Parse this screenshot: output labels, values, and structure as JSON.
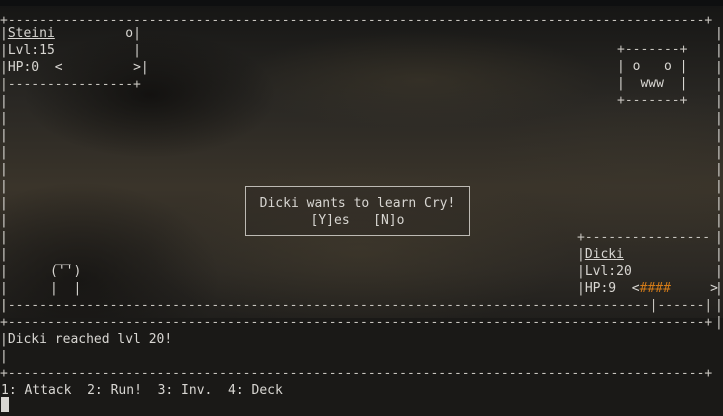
{
  "player": {
    "name": "Steini",
    "marker": "o",
    "level_label": "Lvl:15",
    "hp_label": "HP:0",
    "hp_left": "<",
    "hp_right": ">"
  },
  "enemy_sprite": {
    "line1": "o   o",
    "line2": "www"
  },
  "player_sprite": {
    "line1": "__",
    "line2": "('')",
    "line3": "|  |"
  },
  "pet": {
    "name": "Dicki",
    "level_label": "Lvl:20",
    "hp_label": "HP:9",
    "hp_left": "<",
    "hp_bar": "####",
    "hp_right": ">",
    "hp_bar_fraction": 0.45
  },
  "dialog": {
    "message": "Dicki wants to learn Cry!",
    "option_yes": "[Y]es",
    "option_no": "[N]o"
  },
  "log": {
    "message": "Dicki reached lvl 20!"
  },
  "menu": {
    "attack": "1: Attack",
    "run": "2: Run!",
    "inventory": "3: Inv.",
    "deck": "4: Deck"
  },
  "colors": {
    "text": "#d8d6d2",
    "hp_bar": "#d27a18"
  }
}
